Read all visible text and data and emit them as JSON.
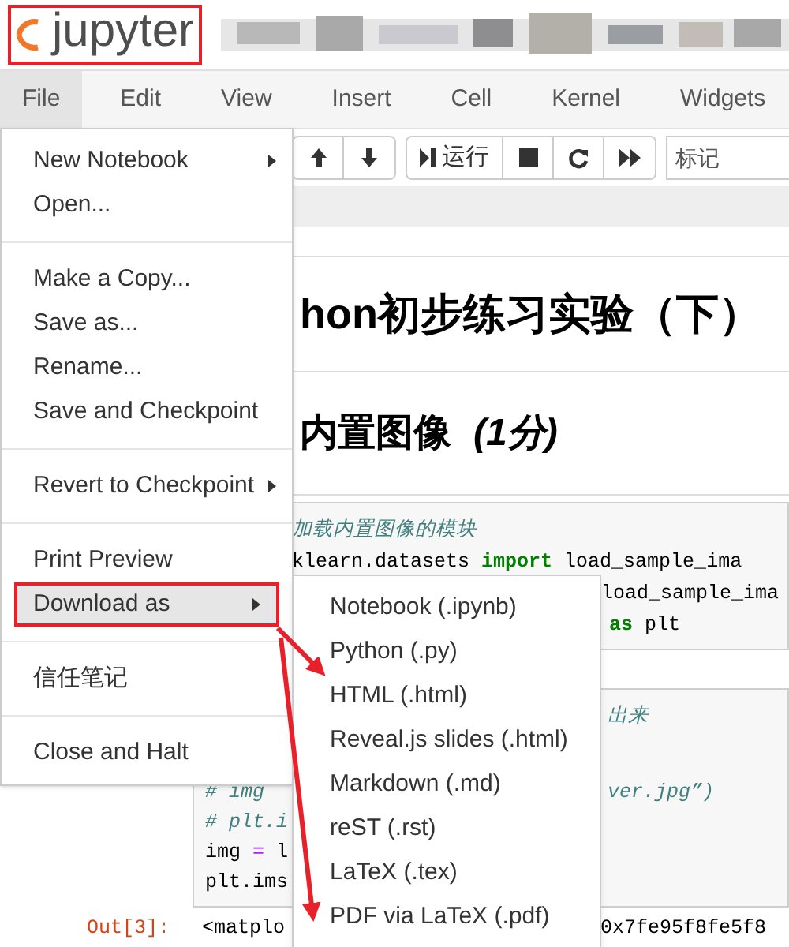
{
  "logo": {
    "text": "jupyter"
  },
  "menubar": [
    {
      "label": "File",
      "selected": true
    },
    {
      "label": "Edit",
      "selected": false
    },
    {
      "label": "View",
      "selected": false
    },
    {
      "label": "Insert",
      "selected": false
    },
    {
      "label": "Cell",
      "selected": false
    },
    {
      "label": "Kernel",
      "selected": false
    },
    {
      "label": "Widgets",
      "selected": false
    }
  ],
  "toolbar": {
    "run_label": "运行",
    "cell_type": "标记"
  },
  "notebook": {
    "title": "hon初步练习实验（下）",
    "heading": "内置图像",
    "heading_score": "(1分)",
    "cells": [
      {
        "lines": [
          [
            [
              {
                "text": "加载内置图像的模块",
                "kind": "comment"
              }
            ]
          ],
          [
            [
              {
                "text": "klearn.datasets ",
                "kind": "plain"
              },
              {
                "text": "import",
                "kind": "keyword"
              },
              {
                "text": " load_sample_ima",
                "kind": "plain"
              }
            ]
          ],
          [
            [
              {
                "text": "load_sample_ima",
                "kind": "plain"
              }
            ]
          ],
          [
            [
              {
                "text": "as",
                "kind": "keyword"
              },
              {
                "text": " plt",
                "kind": "plain"
              }
            ]
          ]
        ]
      },
      {
        "lines": [
          [
            [
              {
                "text": "出来",
                "kind": "comment"
              }
            ]
          ],
          [
            [
              {
                "text": "# img",
                "kind": "comment"
              }
            ],
            [
              {
                "text": "ver.jpg”)",
                "kind": "comment"
              }
            ]
          ],
          [
            [
              {
                "text": "# plt.i",
                "kind": "comment"
              }
            ]
          ],
          [
            [
              {
                "text": "img ",
                "kind": "plain"
              },
              {
                "text": "=",
                "kind": "operator"
              },
              {
                "text": " l",
                "kind": "plain"
              }
            ]
          ],
          [
            [
              {
                "text": "plt.ims",
                "kind": "plain"
              }
            ]
          ]
        ]
      }
    ],
    "output": {
      "prompt": "Out[3]:",
      "parts": [
        "<matplo",
        "0x7fe95f8fe5f8"
      ]
    }
  },
  "file_menu": [
    {
      "kind": "item",
      "label": "New Notebook",
      "has_submenu": true,
      "selected": false
    },
    {
      "kind": "item",
      "label": "Open...",
      "has_submenu": false,
      "selected": false
    },
    {
      "kind": "divider"
    },
    {
      "kind": "item",
      "label": "Make a Copy...",
      "has_submenu": false,
      "selected": false
    },
    {
      "kind": "item",
      "label": "Save as...",
      "has_submenu": false,
      "selected": false
    },
    {
      "kind": "item",
      "label": "Rename...",
      "has_submenu": false,
      "selected": false
    },
    {
      "kind": "item",
      "label": "Save and Checkpoint",
      "has_submenu": false,
      "selected": false
    },
    {
      "kind": "divider"
    },
    {
      "kind": "item",
      "label": "Revert to Checkpoint",
      "has_submenu": true,
      "selected": false
    },
    {
      "kind": "divider"
    },
    {
      "kind": "item",
      "label": "Print Preview",
      "has_submenu": false,
      "selected": false
    },
    {
      "kind": "item",
      "label": "Download as",
      "has_submenu": true,
      "selected": true
    },
    {
      "kind": "divider"
    },
    {
      "kind": "item",
      "label": "信任笔记",
      "has_submenu": false,
      "selected": false
    },
    {
      "kind": "divider"
    },
    {
      "kind": "item",
      "label": "Close and Halt",
      "has_submenu": false,
      "selected": false
    }
  ],
  "download_menu": [
    "Notebook (.ipynb)",
    "Python (.py)",
    "HTML (.html)",
    "Reveal.js slides (.html)",
    "Markdown (.md)",
    "reST (.rst)",
    "LaTeX (.tex)",
    "PDF via LaTeX (.pdf)"
  ]
}
